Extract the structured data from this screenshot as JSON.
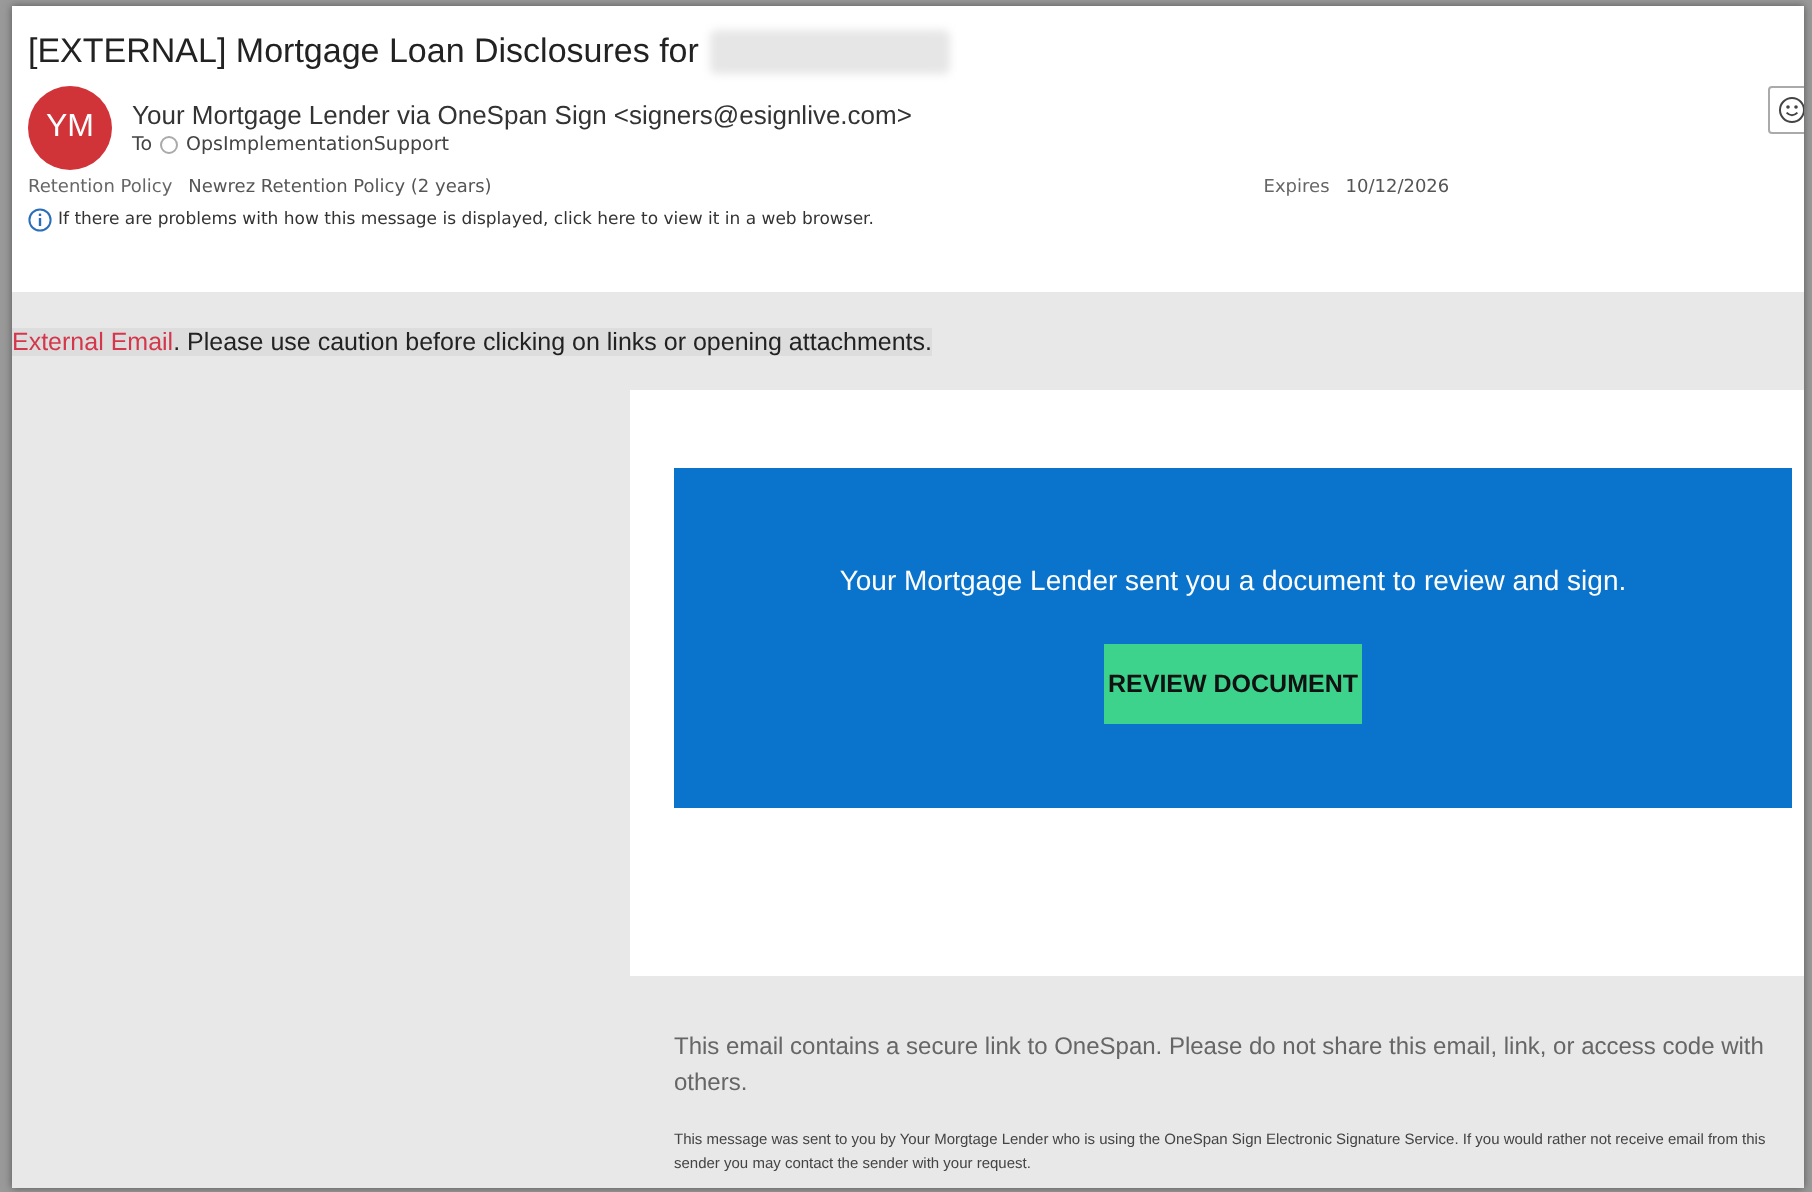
{
  "subject": "[EXTERNAL] Mortgage Loan Disclosures for",
  "sender": {
    "initials": "YM",
    "from": "Your Mortgage Lender via OneSpan Sign <signers@esignlive.com>",
    "to_label": "To",
    "to": "OpsImplementationSupport"
  },
  "retention": {
    "label": "Retention Policy",
    "value": "Newrez Retention Policy (2 years)",
    "expires_label": "Expires",
    "expires": "10/12/2026"
  },
  "info_bar": "If there are problems with how this message is displayed, click here to view it in a web browser.",
  "warning": {
    "tag": "External Email",
    "text": ". Please use caution before clicking on links or opening attachments."
  },
  "card": {
    "message": "Your Mortgage Lender sent you a document to review and sign.",
    "button": "REVIEW DOCUMENT"
  },
  "footer": {
    "notice": "This email contains a secure link to OneSpan. Please do not share this email, link, or access code with others.",
    "small": "This message was sent to you by Your Morgtage Lender who is using the OneSpan Sign Electronic Signature Service. If you would rather not receive email from this sender you may contact the sender with your request."
  }
}
